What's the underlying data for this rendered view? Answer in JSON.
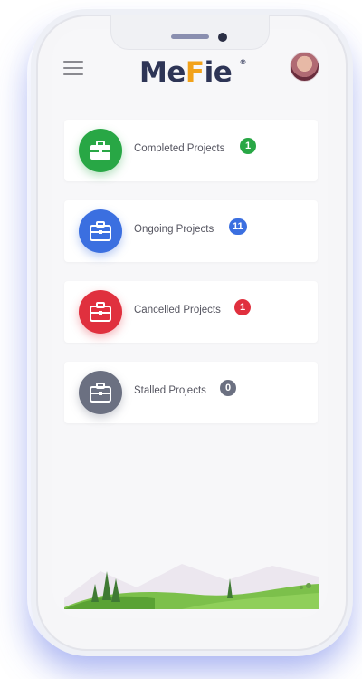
{
  "header": {
    "logo_text_left": "Me",
    "logo_text_key": "F",
    "logo_text_right": "ie",
    "logo_mark": "®"
  },
  "icons": {
    "menu": "hamburger-icon",
    "avatar": "user-avatar",
    "briefcase": "briefcase-icon"
  },
  "colors": {
    "completed": "#28a745",
    "ongoing": "#3b6fe0",
    "cancelled": "#e0303e",
    "stalled": "#6b7081",
    "brand_dark": "#2e3556",
    "brand_key": "#f2a21a"
  },
  "projects": [
    {
      "label": "Completed Projects",
      "count": "1"
    },
    {
      "label": "Ongoing Projects",
      "count": "11"
    },
    {
      "label": "Cancelled Projects",
      "count": "1"
    },
    {
      "label": "Stalled Projects",
      "count": "0"
    }
  ]
}
